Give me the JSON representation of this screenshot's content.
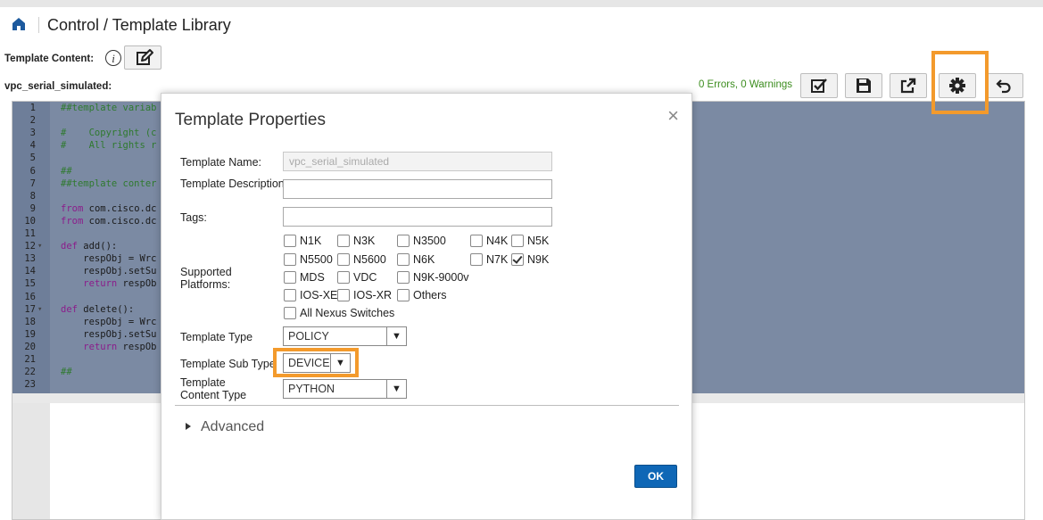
{
  "header": {
    "breadcrumb": "Control / Template Library"
  },
  "content_bar": {
    "label": "Template Content:",
    "info_glyph": "i"
  },
  "file_bar": {
    "file_name": "vpc_serial_simulated:",
    "status": "0 Errors, 0 Warnings",
    "buttons": [
      "validate-icon",
      "save-icon",
      "open-external-icon",
      "settings-icon",
      "undo-icon"
    ]
  },
  "editor": {
    "lines": [
      {
        "n": "1",
        "fold": "",
        "t": "##template variab",
        "cls": "c-com"
      },
      {
        "n": "2",
        "fold": "",
        "t": "",
        "cls": ""
      },
      {
        "n": "3",
        "fold": "",
        "t": "#    Copyright (c",
        "cls": "c-com"
      },
      {
        "n": "4",
        "fold": "",
        "t": "#    All rights r",
        "cls": "c-com"
      },
      {
        "n": "5",
        "fold": "",
        "t": "",
        "cls": ""
      },
      {
        "n": "6",
        "fold": "",
        "t": "##",
        "cls": "c-com"
      },
      {
        "n": "7",
        "fold": "",
        "t": "##template conter",
        "cls": "c-com"
      },
      {
        "n": "8",
        "fold": "",
        "t": "",
        "cls": ""
      },
      {
        "n": "9",
        "fold": "",
        "t": "from com.cisco.dc",
        "cls": "mix-from"
      },
      {
        "n": "10",
        "fold": "",
        "t": "from com.cisco.dc",
        "cls": "mix-from"
      },
      {
        "n": "11",
        "fold": "",
        "t": "",
        "cls": ""
      },
      {
        "n": "12",
        "fold": "▾",
        "t": "def add():",
        "cls": "mix-def"
      },
      {
        "n": "13",
        "fold": "",
        "t": "    respObj = Wrc",
        "cls": ""
      },
      {
        "n": "14",
        "fold": "",
        "t": "    respObj.setSu",
        "cls": ""
      },
      {
        "n": "15",
        "fold": "",
        "t": "    return respOb",
        "cls": "mix-ret"
      },
      {
        "n": "16",
        "fold": "",
        "t": "",
        "cls": ""
      },
      {
        "n": "17",
        "fold": "▾",
        "t": "def delete():",
        "cls": "mix-def"
      },
      {
        "n": "18",
        "fold": "",
        "t": "    respObj = Wrc",
        "cls": ""
      },
      {
        "n": "19",
        "fold": "",
        "t": "    respObj.setSu",
        "cls": ""
      },
      {
        "n": "20",
        "fold": "",
        "t": "    return respOb",
        "cls": "mix-ret"
      },
      {
        "n": "21",
        "fold": "",
        "t": "",
        "cls": ""
      },
      {
        "n": "22",
        "fold": "",
        "t": "##",
        "cls": "c-com"
      },
      {
        "n": "23",
        "fold": "",
        "t": "",
        "cls": ""
      }
    ]
  },
  "dialog": {
    "title": "Template Properties",
    "close_glyph": "×",
    "fields": {
      "name_label": "Template Name:",
      "name_value": "vpc_serial_simulated",
      "desc_label": "Template Description:",
      "desc_value": "",
      "tags_label": "Tags:",
      "tags_value": "",
      "platforms_label": "Supported Platforms:",
      "type_label": "Template Type",
      "type_value": "POLICY",
      "subtype_label": "Template Sub Type",
      "subtype_value": "DEVICE",
      "content_type_label": "Template Content Type",
      "content_type_value": "PYTHON"
    },
    "platforms": [
      {
        "label": "N1K",
        "checked": false
      },
      {
        "label": "N3K",
        "checked": false
      },
      {
        "label": "N3500",
        "checked": false
      },
      {
        "label": "N4K",
        "checked": false
      },
      {
        "label": "N5K",
        "checked": false
      },
      {
        "label": "N5500",
        "checked": false
      },
      {
        "label": "N5600",
        "checked": false
      },
      {
        "label": "N6K",
        "checked": false
      },
      {
        "label": "N7K",
        "checked": false
      },
      {
        "label": "N9K",
        "checked": true
      },
      {
        "label": "MDS",
        "checked": false
      },
      {
        "label": "VDC",
        "checked": false
      },
      {
        "label": "N9K-9000v",
        "checked": false
      },
      {
        "label": "IOS-XE",
        "checked": false
      },
      {
        "label": "IOS-XR",
        "checked": false
      },
      {
        "label": "Others",
        "checked": false
      },
      {
        "label": "All Nexus Switches",
        "checked": false
      }
    ],
    "advanced_label": "Advanced",
    "ok_label": "OK"
  },
  "colors": {
    "accent": "#f39a2c",
    "primary": "#0f67b6",
    "status_ok": "#3c8d1f",
    "selection": "#7b8aa3"
  }
}
